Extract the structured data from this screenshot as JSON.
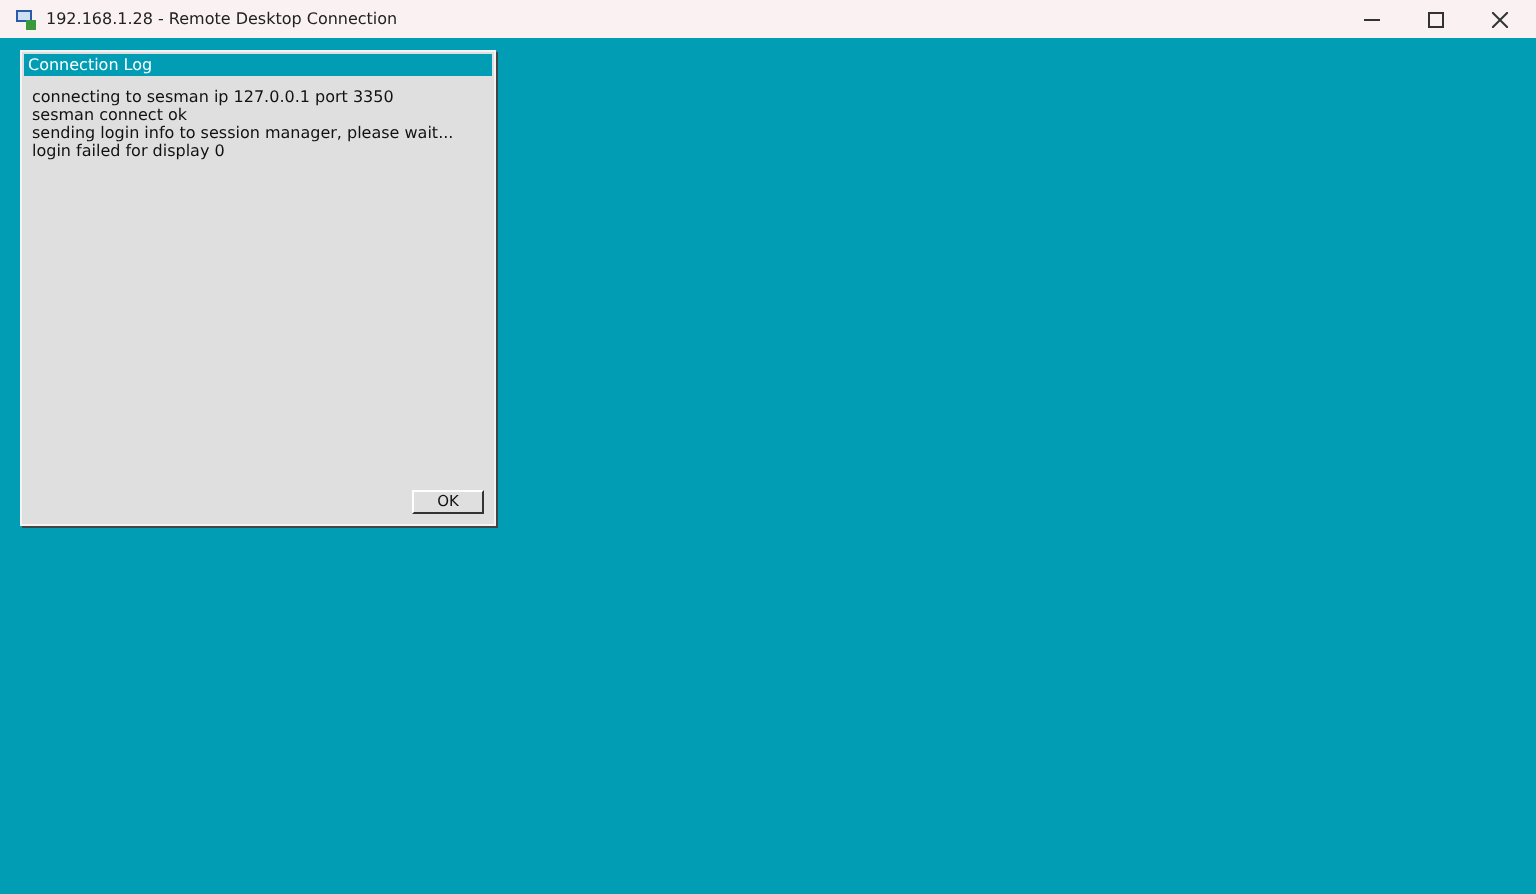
{
  "window": {
    "title": "192.168.1.28 - Remote Desktop Connection"
  },
  "dialog": {
    "title": "Connection Log",
    "lines": [
      "connecting to sesman ip 127.0.0.1 port 3350",
      "sesman connect ok",
      "sending login info to session manager, please wait...",
      "login failed for display 0"
    ],
    "button": "OK"
  }
}
